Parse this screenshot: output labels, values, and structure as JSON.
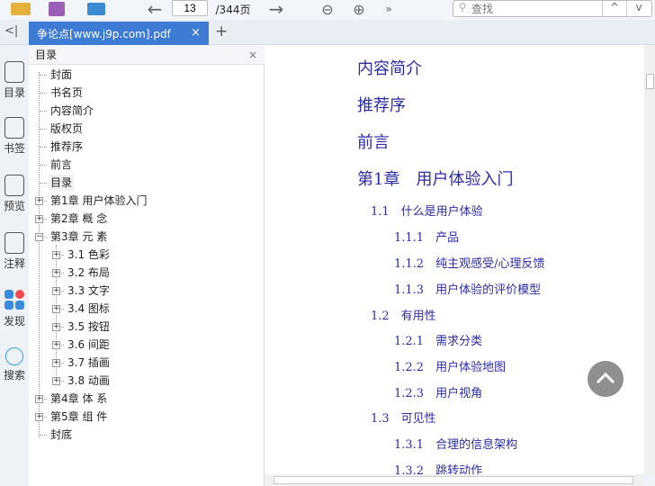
{
  "toolbar": {
    "page_current": "13",
    "page_total": "/344页",
    "search_placeholder": "查找",
    "more": "»"
  },
  "tab": {
    "title": "争论点[www.j9p.com].pdf",
    "close": "×",
    "add": "+",
    "collapse": "<|"
  },
  "sidebar": {
    "items": [
      {
        "label": "目录",
        "icon": "list-icon"
      },
      {
        "label": "书签",
        "icon": "bookmark-icon"
      },
      {
        "label": "预览",
        "icon": "preview-icon"
      },
      {
        "label": "注释",
        "icon": "note-icon"
      },
      {
        "label": "发现",
        "icon": "discover-icon"
      },
      {
        "label": "搜索",
        "icon": "search-icon"
      }
    ]
  },
  "toc": {
    "title": "目录",
    "close": "×",
    "items": [
      {
        "label": "封面",
        "level": 0,
        "toggle": ""
      },
      {
        "label": "书名页",
        "level": 0,
        "toggle": ""
      },
      {
        "label": "内容简介",
        "level": 0,
        "toggle": ""
      },
      {
        "label": "版权页",
        "level": 0,
        "toggle": ""
      },
      {
        "label": "推荐序",
        "level": 0,
        "toggle": ""
      },
      {
        "label": "前言",
        "level": 0,
        "toggle": ""
      },
      {
        "label": "目录",
        "level": 0,
        "toggle": "",
        "selected": true
      },
      {
        "label": "第1章 用户体验入门",
        "level": 0,
        "toggle": "+"
      },
      {
        "label": "第2章 概 念",
        "level": 0,
        "toggle": "+"
      },
      {
        "label": "第3章 元 素",
        "level": 0,
        "toggle": "-"
      },
      {
        "label": "3.1 色彩",
        "level": 1,
        "toggle": "+"
      },
      {
        "label": "3.2 布局",
        "level": 1,
        "toggle": "+"
      },
      {
        "label": "3.3 文字",
        "level": 1,
        "toggle": "+"
      },
      {
        "label": "3.4 图标",
        "level": 1,
        "toggle": "+"
      },
      {
        "label": "3.5 按钮",
        "level": 1,
        "toggle": "+"
      },
      {
        "label": "3.6 间距",
        "level": 1,
        "toggle": "+"
      },
      {
        "label": "3.7 插画",
        "level": 1,
        "toggle": "+"
      },
      {
        "label": "3.8 动画",
        "level": 1,
        "toggle": "+"
      },
      {
        "label": "第4章 体 系",
        "level": 0,
        "toggle": "+"
      },
      {
        "label": "第5章 组 件",
        "level": 0,
        "toggle": "+"
      },
      {
        "label": "封底",
        "level": 0,
        "toggle": ""
      }
    ]
  },
  "document": {
    "lines": [
      {
        "text": "内容简介",
        "level": 0
      },
      {
        "text": "推荐序",
        "level": 0
      },
      {
        "text": "前言",
        "level": 0
      },
      {
        "text": "第1章　用户体验入门",
        "level": 0
      },
      {
        "text": "1.1　什么是用户体验",
        "level": 1
      },
      {
        "text": "1.1.1　产品",
        "level": 2
      },
      {
        "text": "1.1.2　纯主观感受/心理反馈",
        "level": 2
      },
      {
        "text": "1.1.3　用户体验的评价模型",
        "level": 2
      },
      {
        "text": "1.2　有用性",
        "level": 1
      },
      {
        "text": "1.2.1　需求分类",
        "level": 2
      },
      {
        "text": "1.2.2　用户体验地图",
        "level": 2
      },
      {
        "text": "1.2.3　用户视角",
        "level": 2
      },
      {
        "text": "1.3　可见性",
        "level": 1
      },
      {
        "text": "1.3.1　合理的信息架构",
        "level": 2
      },
      {
        "text": "1.3.2　跳转动作",
        "level": 2
      }
    ]
  },
  "colors": {
    "accent": "#3d7bd4",
    "doc_text": "#2b2ba8"
  }
}
